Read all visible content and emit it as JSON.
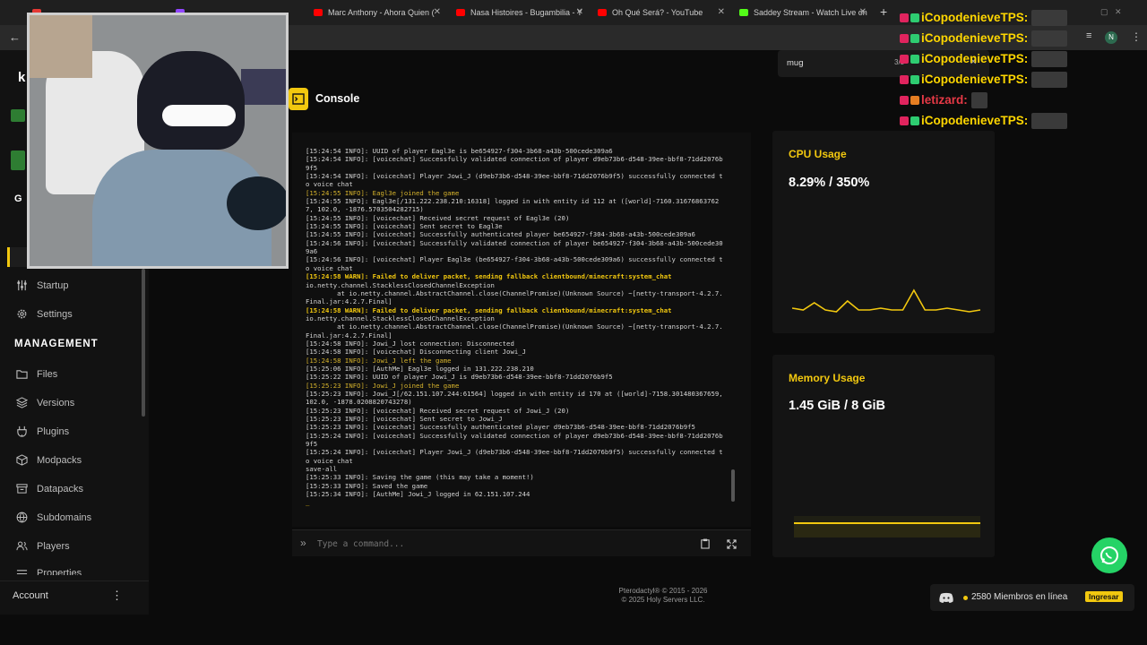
{
  "browser": {
    "tabs": [
      {
        "title": "",
        "favicon_color": "#e53935"
      },
      {
        "title": "",
        "favicon_color": "#9146ff"
      },
      {
        "title": "Marc Anthony - Ahora Quien (",
        "favicon_color": "#ff0000"
      },
      {
        "title": "Nasa Histoires - Bugambilia - Y",
        "favicon_color": "#ff0000"
      },
      {
        "title": "Oh Qué Será? - YouTube",
        "favicon_color": "#ff0000"
      },
      {
        "title": "Saddey Stream - Watch Live on",
        "favicon_color": "#53fc18"
      }
    ],
    "new_tab": "+",
    "profile_initial": "N"
  },
  "sidebar": {
    "items_top": [
      {
        "label": "Startup",
        "icon": "sliders-icon"
      },
      {
        "label": "Settings",
        "icon": "gear-icon"
      }
    ],
    "management_heading": "MANAGEMENT",
    "items_management": [
      {
        "label": "Files",
        "icon": "folder-icon"
      },
      {
        "label": "Versions",
        "icon": "layers-icon"
      },
      {
        "label": "Plugins",
        "icon": "plug-icon"
      },
      {
        "label": "Modpacks",
        "icon": "package-icon"
      },
      {
        "label": "Datapacks",
        "icon": "archive-icon"
      },
      {
        "label": "Subdomains",
        "icon": "globe-icon"
      },
      {
        "label": "Players",
        "icon": "users-icon"
      },
      {
        "label": "Properties",
        "icon": "list-icon"
      }
    ],
    "account_label": "Account",
    "partial_heading": "G"
  },
  "console": {
    "title": "Console",
    "command_placeholder": "Type a command...",
    "prompt": "»",
    "lines": [
      {
        "t": "[15:24:54 INFO]: UUID of player Eagl3e is be654927-f304-3b68-a43b-500cede309a6",
        "k": "info"
      },
      {
        "t": "[15:24:54 INFO]: [voicechat] Successfully validated connection of player d9eb73b6-d548-39ee-bbf8-71dd2076b9f5",
        "k": "info"
      },
      {
        "t": "[15:24:54 INFO]: [voicechat] Player Jowi_J (d9eb73b6-d548-39ee-bbf8-71dd2076b9f5) successfully connected to voice chat",
        "k": "info"
      },
      {
        "t": "[15:24:55 INFO]: Eagl3e joined the game",
        "k": "join"
      },
      {
        "t": "[15:24:55 INFO]: Eagl3e[/131.222.238.210:16318] logged in with entity id 112 at ([world]-7160.316768637627, 102.0, -1876.5703504282715)",
        "k": "info"
      },
      {
        "t": "[15:24:55 INFO]: [voicechat] Received secret request of Eagl3e (20)",
        "k": "info"
      },
      {
        "t": "[15:24:55 INFO]: [voicechat] Sent secret to Eagl3e",
        "k": "info"
      },
      {
        "t": "[15:24:55 INFO]: [voicechat] Successfully authenticated player be654927-f304-3b68-a43b-500cede309a6",
        "k": "info"
      },
      {
        "t": "[15:24:56 INFO]: [voicechat] Successfully validated connection of player be654927-f304-3b68-a43b-500cede309a6",
        "k": "info"
      },
      {
        "t": "[15:24:56 INFO]: [voicechat] Player Eagl3e (be654927-f304-3b68-a43b-500cede309a6) successfully connected to voice chat",
        "k": "info"
      },
      {
        "t": "[15:24:58 WARN]: Failed to deliver packet, sending fallback clientbound/minecraft:system_chat",
        "k": "warn"
      },
      {
        "t": "io.netty.channel.StacklessClosedChannelException",
        "k": "info"
      },
      {
        "t": "        at io.netty.channel.AbstractChannel.close(ChannelPromise)(Unknown Source) ~[netty-transport-4.2.7.Final.jar:4.2.7.Final]",
        "k": "info"
      },
      {
        "t": "[15:24:58 WARN]: Failed to deliver packet, sending fallback clientbound/minecraft:system_chat",
        "k": "warn"
      },
      {
        "t": "io.netty.channel.StacklessClosedChannelException",
        "k": "info"
      },
      {
        "t": "        at io.netty.channel.AbstractChannel.close(ChannelPromise)(Unknown Source) ~[netty-transport-4.2.7.Final.jar:4.2.7.Final]",
        "k": "info"
      },
      {
        "t": "[15:24:58 INFO]: Jowi_J lost connection: Disconnected",
        "k": "info"
      },
      {
        "t": "[15:24:58 INFO]: [voicechat] Disconnecting client Jowi_J",
        "k": "info"
      },
      {
        "t": "[15:24:58 INFO]: Jowi_J left the game",
        "k": "join"
      },
      {
        "t": "[15:25:06 INFO]: [AuthMe] Eagl3e logged in 131.222.238.210",
        "k": "info"
      },
      {
        "t": "[15:25:22 INFO]: UUID of player Jowi_J is d9eb73b6-d548-39ee-bbf8-71dd2076b9f5",
        "k": "info"
      },
      {
        "t": "[15:25:23 INFO]: Jowi_J joined the game",
        "k": "join"
      },
      {
        "t": "[15:25:23 INFO]: Jowi_J[/62.151.107.244:61564] logged in with entity id 170 at ([world]-7158.301480367659, 102.0, -1878.0208820743278)",
        "k": "info"
      },
      {
        "t": "[15:25:23 INFO]: [voicechat] Received secret request of Jowi_J (20)",
        "k": "info"
      },
      {
        "t": "[15:25:23 INFO]: [voicechat] Sent secret to Jowi_J",
        "k": "info"
      },
      {
        "t": "[15:25:23 INFO]: [voicechat] Successfully authenticated player d9eb73b6-d548-39ee-bbf8-71dd2076b9f5",
        "k": "info"
      },
      {
        "t": "[15:25:24 INFO]: [voicechat] Successfully validated connection of player d9eb73b6-d548-39ee-bbf8-71dd2076b9f5",
        "k": "info"
      },
      {
        "t": "[15:25:24 INFO]: [voicechat] Player Jowi_J (d9eb73b6-d548-39ee-bbf8-71dd2076b9f5) successfully connected to voice chat",
        "k": "info"
      },
      {
        "t": "save-all",
        "k": "info"
      },
      {
        "t": "[15:25:33 INFO]: Saving the game (this may take a moment!)",
        "k": "info"
      },
      {
        "t": "[15:25:33 INFO]: Saved the game",
        "k": "info"
      },
      {
        "t": "[15:25:34 INFO]: [AuthMe] Jowi_J logged in 62.151.107.244",
        "k": "info"
      }
    ],
    "cursor": "_"
  },
  "stats": {
    "cpu": {
      "title": "CPU Usage",
      "value": "8.29% / 350%",
      "history": [
        4,
        3,
        7,
        3,
        2,
        8,
        3,
        3,
        4,
        3,
        3,
        14,
        3,
        3,
        4,
        3,
        2,
        3
      ]
    },
    "memory": {
      "title": "Memory Usage",
      "value": "1.45 GiB / 8 GiB",
      "used_fraction": 0.18
    }
  },
  "find_bar": {
    "query": "mug",
    "count": "3/3"
  },
  "chat": {
    "messages": [
      {
        "user": "iCopodenieveTPS:",
        "color": "#ffd700"
      },
      {
        "user": "iCopodenieveTPS:",
        "color": "#ffd700"
      },
      {
        "user": "iCopodenieveTPS:",
        "color": "#ffd700"
      },
      {
        "user": "iCopodenieveTPS:",
        "color": "#ffd700"
      },
      {
        "user": "letizard:",
        "color": "#e63946"
      },
      {
        "user": "iCopodenieveTPS:",
        "color": "#ffd700"
      }
    ]
  },
  "footer": {
    "line1": "Pterodactyl® © 2015 - 2026",
    "line2": "© 2025 Holy Servers LLC."
  },
  "discord": {
    "members": "2580 Miembros en línea",
    "join_label": "Ingresar"
  },
  "colors": {
    "accent": "#f2c80f",
    "bg": "#0b0b0b",
    "panel": "#141414"
  }
}
